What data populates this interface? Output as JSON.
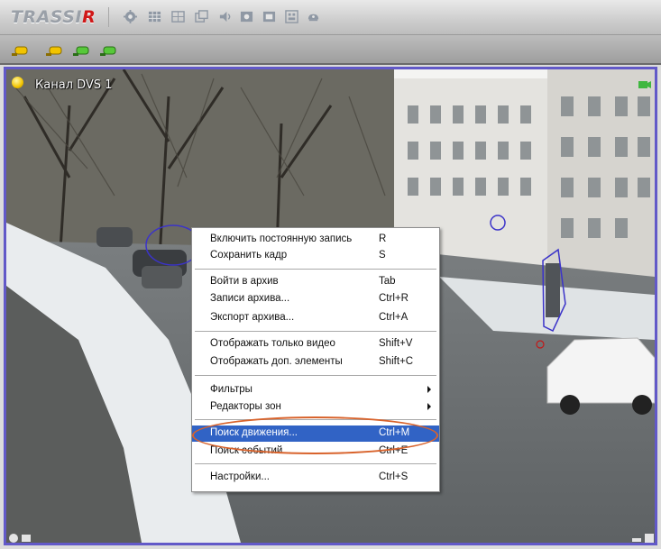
{
  "app": {
    "logo_main": "TRASSI",
    "logo_accent": "R"
  },
  "toolbar": {
    "icons": [
      "settings-icon",
      "layout-grid-icon",
      "layout-quad-icon",
      "window-icon",
      "volume-icon",
      "record-icon",
      "fullscreen-icon",
      "screenshot-icon",
      "archive-icon"
    ]
  },
  "channel_bar": {
    "buttons": [
      "channel-1",
      "channel-2",
      "channel-3",
      "channel-4"
    ],
    "colors": [
      "#f2c400",
      "#f2c400",
      "#57c83a",
      "#57c83a"
    ]
  },
  "camera": {
    "label": "Канал DVS 1"
  },
  "menu": {
    "items": [
      {
        "label": "Включить постоянную запись",
        "shortcut": "R"
      },
      {
        "label": "Сохранить кадр",
        "shortcut": "S"
      },
      {
        "label": "Войти в архив",
        "shortcut": "Tab"
      },
      {
        "label": "Записи архива...",
        "shortcut": "Ctrl+R"
      },
      {
        "label": "Экспорт архива...",
        "shortcut": "Ctrl+A"
      },
      {
        "label": "Отображать только видео",
        "shortcut": "Shift+V"
      },
      {
        "label": "Отображать доп. элементы",
        "shortcut": "Shift+C"
      },
      {
        "label": "Фильтры",
        "shortcut": ""
      },
      {
        "label": "Редакторы зон",
        "shortcut": ""
      },
      {
        "label": "Поиск движения...",
        "shortcut": "Ctrl+M"
      },
      {
        "label": "Поиск событий...",
        "shortcut": "Ctrl+E"
      },
      {
        "label": "Настройки...",
        "shortcut": "Ctrl+S"
      }
    ]
  },
  "colors": {
    "highlight": "#3163c5",
    "annotation_ring": "#d8632c",
    "video_border": "#6259c8"
  }
}
